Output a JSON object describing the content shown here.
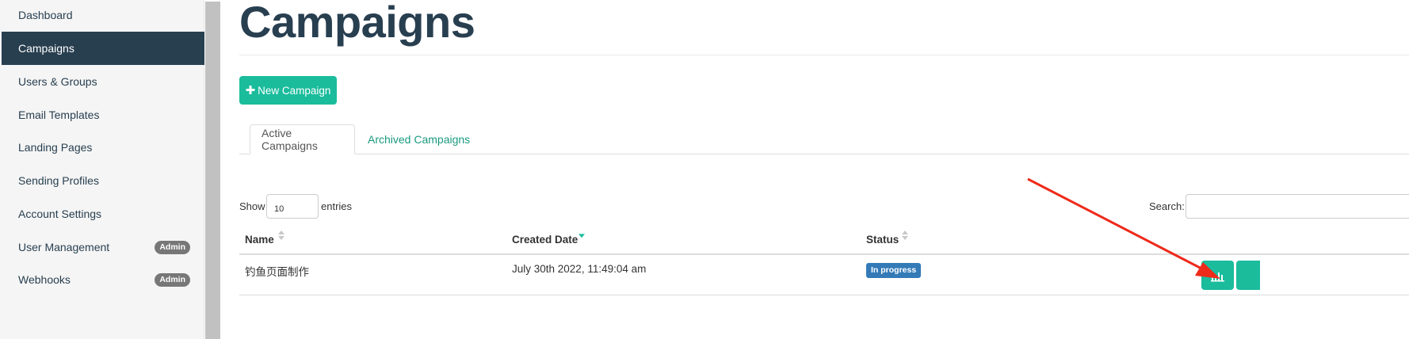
{
  "sidebar": {
    "items": [
      {
        "label": "Dashboard"
      },
      {
        "label": "Campaigns",
        "active": true
      },
      {
        "label": "Users & Groups"
      },
      {
        "label": "Email Templates"
      },
      {
        "label": "Landing Pages"
      },
      {
        "label": "Sending Profiles"
      },
      {
        "label": "Account Settings"
      },
      {
        "label": "User Management",
        "badge": "Admin"
      },
      {
        "label": "Webhooks",
        "badge": "Admin"
      }
    ]
  },
  "page": {
    "title": "Campaigns",
    "new_button": {
      "icon": "plus-icon",
      "label": "New Campaign"
    },
    "tabs": [
      {
        "label": "Active Campaigns",
        "active": true
      },
      {
        "label": "Archived Campaigns"
      }
    ]
  },
  "table": {
    "show_label": "Show",
    "page_length": "10",
    "entries_label": "entries",
    "search_label": "Search:",
    "columns": [
      {
        "label": "Name",
        "sort": "none"
      },
      {
        "label": "Created Date",
        "sort": "descending"
      },
      {
        "label": "Status",
        "sort": "none"
      }
    ],
    "rows": [
      {
        "name": "钓鱼页面制作",
        "created_date": "July 30th 2022, 11:49:04 am",
        "status": "In progress",
        "action_icon": "bar-chart-icon"
      }
    ]
  },
  "colors": {
    "sidebar_active": "#283f50",
    "primary": "#1abc9c",
    "status_badge": "#337ab7",
    "annotation_arrow": "#ee2a1b"
  }
}
